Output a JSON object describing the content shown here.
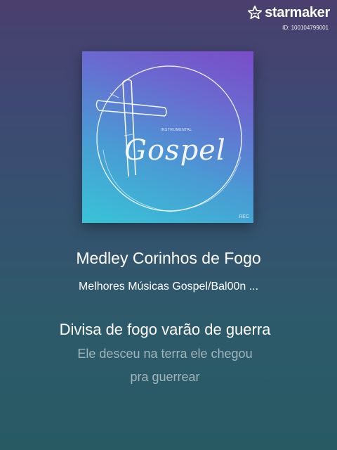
{
  "watermark": {
    "brand": "starmaker",
    "id_text": "ID: 100104799001",
    "icon": "star-logo-icon"
  },
  "cover": {
    "logo_word": "Gospel",
    "logo_small_text": "INSTRUMENTAL",
    "corner_tag": "REC",
    "icon": "cross-icon"
  },
  "song": {
    "title": "Medley Corinhos de Fogo",
    "artist": "Melhores Músicas Gospel/Bal00n ..."
  },
  "lyrics": {
    "current": "Divisa de fogo varão de guerra",
    "next": "Ele desceu na terra ele chegou",
    "next2": "pra guerrear"
  },
  "colors": {
    "background_top": "#4a3f6e",
    "background_bottom": "#285a64",
    "cover_top": "#7a4cc8",
    "cover_bottom": "#38c4d6"
  }
}
